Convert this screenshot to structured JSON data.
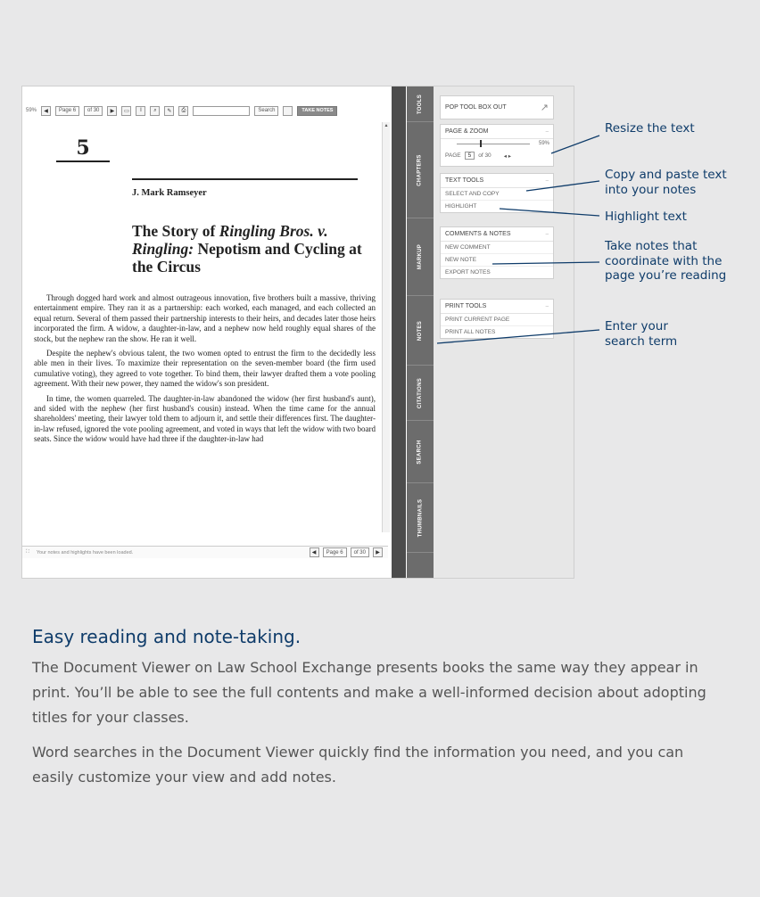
{
  "toolbar": {
    "zoom": "59%",
    "page_label": "Page",
    "page_value": "6",
    "of_label": "of 30",
    "search_label": "Search",
    "take_notes": "TAKE NOTES"
  },
  "document": {
    "chapter_number": "5",
    "author": "J. Mark Ramseyer",
    "title_part1": "The Story of ",
    "title_italic1": "Ringling Bros. v. Ringling:",
    "title_part2": " Nepotism and Cycling at the Circus",
    "paragraphs": [
      "Through dogged hard work and almost outrageous innovation, five brothers built a massive, thriving entertainment empire. They ran it as a partnership: each worked, each managed, and each collected an equal return. Several of them passed their partnership interests to their heirs, and decades later those heirs incorporated the firm. A widow, a daughter-in-law, and a nephew now held roughly equal shares of the stock, but the nephew ran the show. He ran it well.",
      "Despite the nephew's obvious talent, the two women opted to entrust the firm to the decidedly less able men in their lives. To maximize their representation on the seven-member board (the firm used cumulative voting), they agreed to vote together. To bind them, their lawyer drafted them a vote pooling agreement. With their new power, they named the widow's son president.",
      "In time, the women quarreled. The daughter-in-law abandoned the widow (her first husband's aunt), and sided with the nephew (her first husband's cousin) instead. When the time came for the annual shareholders' meeting, their lawyer told them to adjourn it, and settle their differences first. The daughter-in-law refused, ignored the vote pooling agreement, and voted in ways that left the widow with two board seats. Since the widow would have had three if the daughter-in-law had"
    ]
  },
  "status_bar": {
    "message": "Your notes and highlights have been loaded.",
    "page_label": "Page",
    "page_value": "6",
    "of_label": "of 30"
  },
  "tabs": [
    "TOOLS",
    "CHAPTERS",
    "MARKUP",
    "NOTES",
    "CITATIONS",
    "SEARCH",
    "THUMBNAILS"
  ],
  "panel": {
    "pop_out": "POP TOOL BOX OUT",
    "page_zoom": {
      "title": "PAGE & ZOOM",
      "zoom_value": "59%",
      "page_label": "PAGE",
      "page_value": "5",
      "of_label": "of 30"
    },
    "text_tools": {
      "title": "TEXT TOOLS",
      "items": [
        "SELECT AND COPY",
        "HIGHLIGHT"
      ]
    },
    "comments": {
      "title": "COMMENTS & NOTES",
      "items": [
        "NEW COMMENT",
        "NEW NOTE",
        "EXPORT NOTES"
      ]
    },
    "print": {
      "title": "PRINT TOOLS",
      "items": [
        "PRINT CURRENT PAGE",
        "PRINT ALL NOTES"
      ]
    }
  },
  "callouts": {
    "resize": "Resize the text",
    "copy_line1": "Copy and paste text",
    "copy_line2": "into your notes",
    "highlight": "Highlight text",
    "notes_line1": "Take notes that",
    "notes_line2": "coordinate with the",
    "notes_line3": "page you’re reading",
    "search_line1": "Enter your",
    "search_line2": "search term"
  },
  "copy": {
    "heading": "Easy reading and note-taking.",
    "paragraph1": "The Document Viewer on Law School Exchange presents books the same way they appear in print. You’ll be able to see the full contents and make a well-informed decision about adopting titles for your classes.",
    "paragraph2": "Word searches in the Document Viewer quickly find the information you need, and you can easily customize your view and add notes."
  },
  "colors": {
    "accent": "#0f3c6a",
    "background": "#e8e8e9",
    "tab_bg": "#6c6c6c"
  }
}
